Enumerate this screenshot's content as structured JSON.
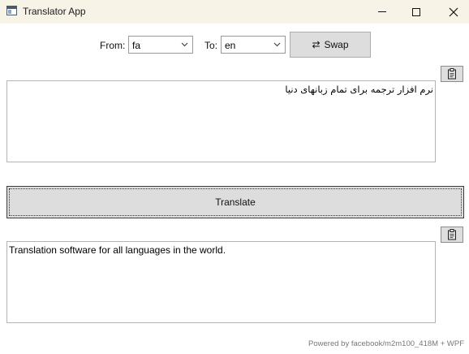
{
  "window": {
    "title": "Translator App",
    "icon": "app-window-icon",
    "controls": [
      "minimize-icon",
      "maximize-icon",
      "close-icon"
    ]
  },
  "toolbar": {
    "from_label": "From:",
    "from_value": "fa",
    "to_label": "To:",
    "to_value": "en",
    "swap_icon": "⇄",
    "swap_label": "Swap"
  },
  "source": {
    "text": "نرم افزار ترجمه برای تمام زبانهای دنیا",
    "copy_icon": "clipboard-icon"
  },
  "translate_button": {
    "label": "Translate"
  },
  "output": {
    "text": "Translation software for all languages in the world.",
    "copy_icon": "clipboard-icon"
  },
  "footer": {
    "text": "Powered by facebook/m2m100_418M + WPF"
  }
}
